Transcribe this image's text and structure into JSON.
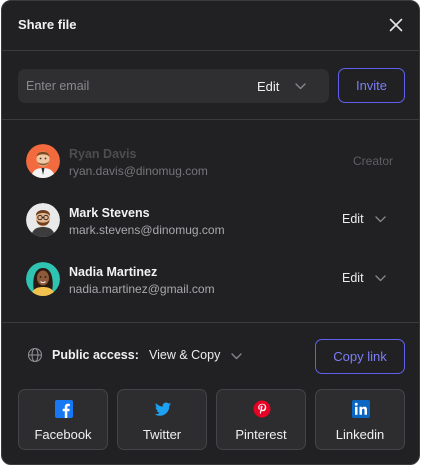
{
  "header": {
    "title": "Share file"
  },
  "invite": {
    "email_placeholder": "Enter email",
    "permission": "Edit",
    "invite_label": "Invite"
  },
  "people": [
    {
      "name": "Ryan Davis",
      "email": "ryan.davis@dinomug.com",
      "role": "Creator"
    },
    {
      "name": "Mark Stevens",
      "email": "mark.stevens@dinomug.com",
      "role": "Edit"
    },
    {
      "name": "Nadia Martinez",
      "email": "nadia.martinez@gmail.com",
      "role": "Edit"
    }
  ],
  "access": {
    "label": "Public access:",
    "value": "View & Copy",
    "copy_link_label": "Copy link"
  },
  "social": [
    {
      "label": "Facebook",
      "icon": "facebook-icon",
      "color": "#1877f2"
    },
    {
      "label": "Twitter",
      "icon": "twitter-icon",
      "color": "#1da1f2"
    },
    {
      "label": "Pinterest",
      "icon": "pinterest-icon",
      "color": "#e60023"
    },
    {
      "label": "Linkedin",
      "icon": "linkedin-icon",
      "color": "#0a66c2"
    }
  ],
  "colors": {
    "accent": "#5e61f0",
    "background": "#212123"
  }
}
